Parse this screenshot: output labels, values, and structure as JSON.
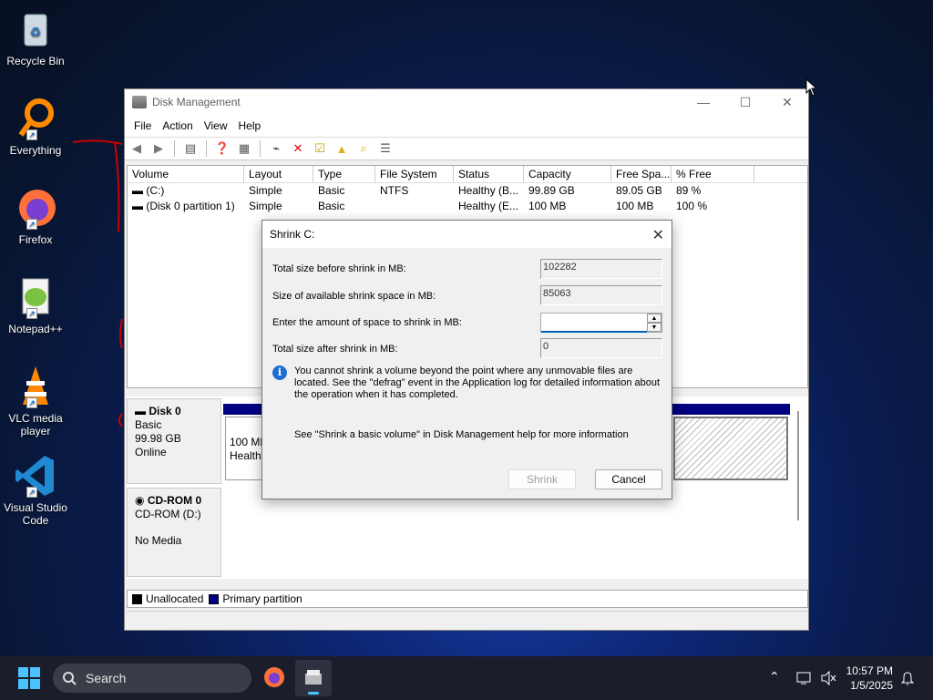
{
  "desktop": {
    "icons": [
      {
        "label": "Recycle Bin"
      },
      {
        "label": "Everything"
      },
      {
        "label": "Firefox"
      },
      {
        "label": "Notepad++"
      },
      {
        "label": "VLC media player"
      },
      {
        "label": "Visual Studio Code"
      }
    ]
  },
  "disk_mgmt": {
    "title": "Disk Management",
    "menu": [
      "File",
      "Action",
      "View",
      "Help"
    ],
    "columns": [
      "Volume",
      "Layout",
      "Type",
      "File System",
      "Status",
      "Capacity",
      "Free Spa...",
      "% Free"
    ],
    "rows": [
      [
        "(C:)",
        "Simple",
        "Basic",
        "NTFS",
        "Healthy (B...",
        "99.89 GB",
        "89.05 GB",
        "89 %"
      ],
      [
        "(Disk 0 partition 1)",
        "Simple",
        "Basic",
        "",
        "Healthy (E...",
        "100 MB",
        "100 MB",
        "100 %"
      ]
    ],
    "disk0": {
      "name": "Disk 0",
      "type": "Basic",
      "size": "99.98 GB",
      "state": "Online",
      "part_size": "100 MB",
      "part_status": "Healthy"
    },
    "cdrom": {
      "name": "CD-ROM 0",
      "drive": "CD-ROM (D:)",
      "media": "No Media"
    },
    "legend": {
      "unallocated": "Unallocated",
      "primary": "Primary partition"
    },
    "colors": {
      "unallocated": "#000000",
      "primary": "#000080"
    }
  },
  "shrink": {
    "title": "Shrink C:",
    "total_before_label": "Total size before shrink in MB:",
    "total_before": "102282",
    "available_label": "Size of available shrink space in MB:",
    "available": "85063",
    "amount_label": "Enter the amount of space to shrink in MB:",
    "amount": "",
    "after_label": "Total size after shrink in MB:",
    "after": "0",
    "info": "You cannot shrink a volume beyond the point where any unmovable files are located. See the \"defrag\" event in the Application log for detailed information about the operation when it has completed.",
    "help": "See \"Shrink a basic volume\" in Disk Management help for more information",
    "shrink_btn": "Shrink",
    "cancel_btn": "Cancel"
  },
  "taskbar": {
    "search": "Search",
    "time": "10:57 PM",
    "date": "1/5/2025"
  }
}
